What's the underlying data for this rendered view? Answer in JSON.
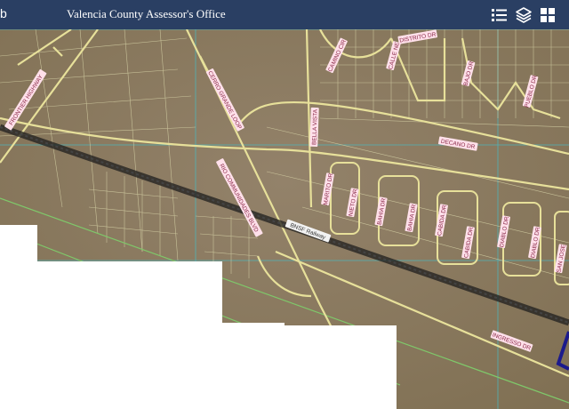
{
  "header": {
    "logo_glyph": "b",
    "title": "Valencia County Assessor's Office",
    "background": "#2a3f63",
    "tools": [
      {
        "name": "legend-list-icon"
      },
      {
        "name": "layers-icon"
      },
      {
        "name": "basemap-gallery-icon"
      }
    ]
  },
  "map": {
    "background": "#8b7a5c",
    "road_color": "#e7e09a",
    "parcel_color": "#d8d4a8",
    "boundary_color": "#7fc86a",
    "grid_color": "#4fb3b8",
    "label_color": "#ffe0ea",
    "label_text_color": "#8a2a4a",
    "selection_color": "#1c1a8c",
    "labels": {
      "frontier": "FRONTIER HIGHWAY",
      "cerro_grande": "CERRO GRANDE LOOP",
      "rio_comunidades": "RIO COMMUNIDADES BLVD",
      "bella_vista": "BELLA VISTA",
      "bnsf": "BNSF Railway",
      "distrito": "DISTRITO DR",
      "camino_cir": "CAMINO CIR",
      "calle_ne": "CALLE NE",
      "decano": "DECANO DR",
      "ingresso": "INGRESSO DR",
      "marito": "MARITO DR",
      "nieto": "NIETO DR",
      "bahia": "BAHIA DR",
      "bahia2": "BAHIA DR",
      "cabida": "CABIDA DR",
      "cabida2": "CABIDA DR",
      "diablo": "DIABLO DR",
      "diablo2": "DIABLO DR",
      "bajo": "BAJO DR",
      "pueblo": "PUEBLO DR",
      "san_jose": "SAN JOSE"
    }
  }
}
